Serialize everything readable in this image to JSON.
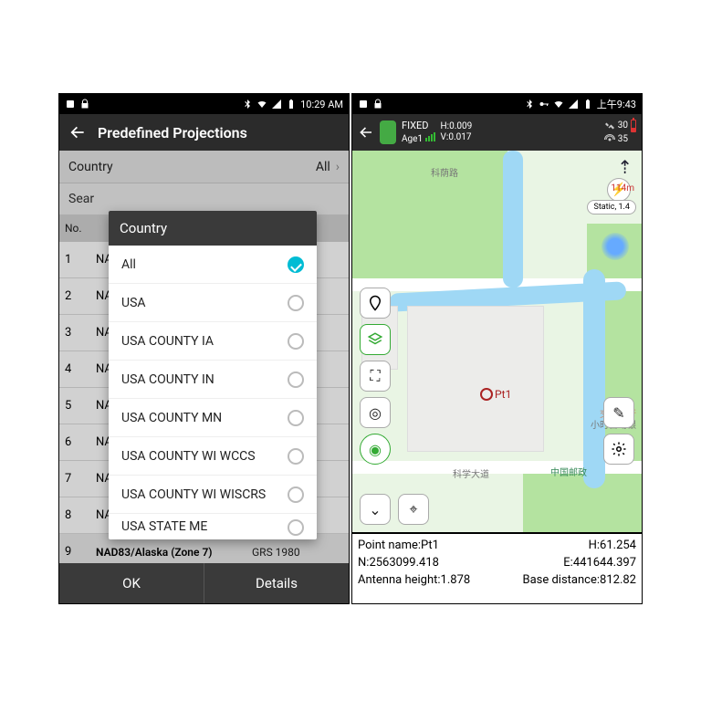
{
  "left": {
    "status": {
      "time": "10:29 AM"
    },
    "title": "Predefined Projections",
    "filter": {
      "label": "Country",
      "value": "All"
    },
    "search_label": "Sear",
    "table": {
      "no_header": "No."
    },
    "rows": [
      {
        "no": "1",
        "name": "NA"
      },
      {
        "no": "2",
        "name": "NA"
      },
      {
        "no": "3",
        "name": "NA"
      },
      {
        "no": "4",
        "name": "NA"
      },
      {
        "no": "5",
        "name": "NA"
      },
      {
        "no": "6",
        "name": "NA"
      },
      {
        "no": "7",
        "name": "NA"
      },
      {
        "no": "8",
        "name": "NA"
      },
      {
        "no": "9",
        "name": "NAD83/Alaska (Zone 7)",
        "grs": "GRS 1980"
      }
    ],
    "dropdown": {
      "title": "Country",
      "items": [
        {
          "label": "All",
          "selected": true
        },
        {
          "label": "USA",
          "selected": false
        },
        {
          "label": "USA COUNTY IA",
          "selected": false
        },
        {
          "label": "USA COUNTY IN",
          "selected": false
        },
        {
          "label": "USA COUNTY MN",
          "selected": false
        },
        {
          "label": "USA COUNTY WI WCCS",
          "selected": false
        },
        {
          "label": "USA COUNTY WI WISCRS",
          "selected": false
        },
        {
          "label": "USA STATE ME",
          "selected": false
        }
      ]
    },
    "buttons": {
      "ok": "OK",
      "details": "Details"
    }
  },
  "right": {
    "status": {
      "time": "上午9:43"
    },
    "gps": {
      "fix": "FIXED",
      "age_label": "Age1",
      "h_label": "H:0.009",
      "v_label": "V:0.017",
      "sat1": "30",
      "sat2": "35"
    },
    "map": {
      "scale": "114m",
      "point_label": "Pt1",
      "chip": "Static, 1.4",
      "cn1": "科荫路",
      "cn2": "科学大道",
      "cn3": "交通银行",
      "cn4": "小时自动银",
      "cn5": "中国邮政"
    },
    "info": {
      "point_name_label": "Point name:",
      "point_name": "Pt1",
      "h_label": "H:",
      "h": "61.254",
      "n_label": "N:",
      "n": "2563099.418",
      "e_label": "E:",
      "e": "441644.397",
      "ant_label": "Antenna height:",
      "ant": "1.878",
      "base_label": "Base distance:",
      "base": "812.82"
    }
  }
}
